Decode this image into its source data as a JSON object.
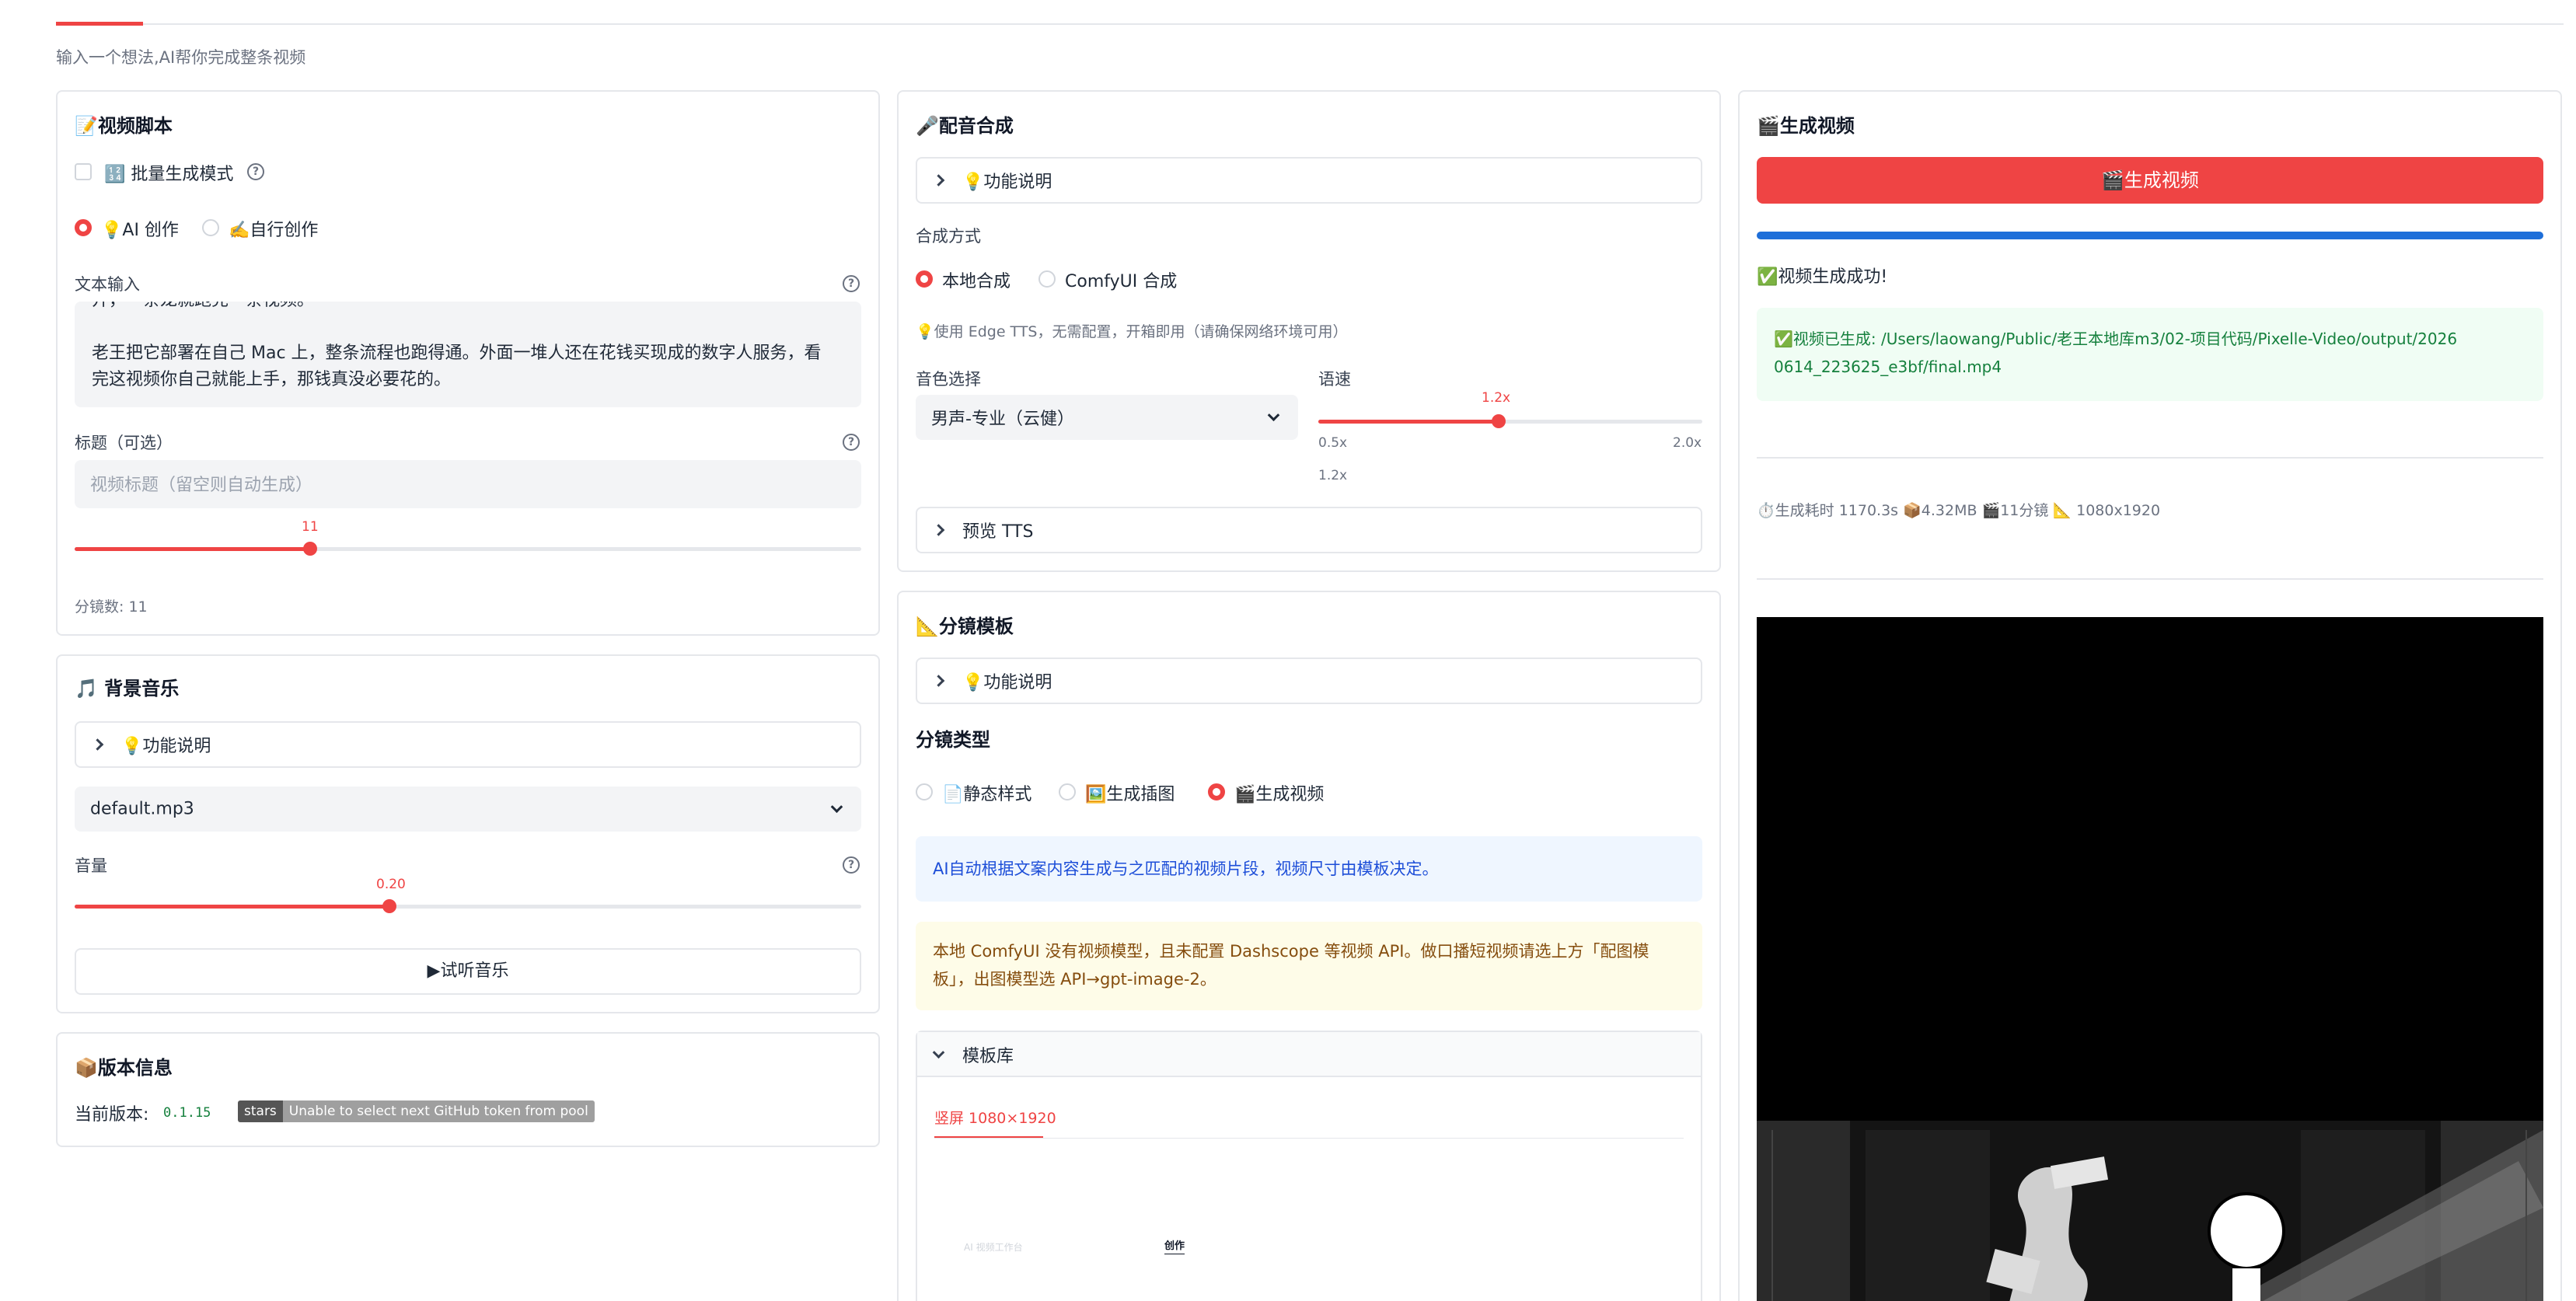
{
  "header": {
    "subtitle": "输入一个想法,AI帮你完成整条视频"
  },
  "script_panel": {
    "title": "📝视频脚本",
    "batch_label": "🔢 批量生成模式",
    "mode_ai": "💡AI 创作",
    "mode_self": "✍️自行创作",
    "text_label": "文本输入",
    "text_value": "开，一条龙就跑完一条视频。\n\n老王把它部署在自己 Mac 上，整条流程也跑得通。外面一堆人还在花钱买现成的数字人服务，看完这视频你自己就能上手，那钱真没必要花的。",
    "title_label": "标题（可选）",
    "title_placeholder": "视频标题（留空则自动生成）",
    "scenes_value": "11",
    "scenes_fraction": 0.3,
    "scenes_text": "分镜数: 11"
  },
  "bgm_panel": {
    "title": "🎵 背景音乐",
    "help_label": "💡功能说明",
    "selected": "default.mp3",
    "volume_label": "音量",
    "volume_value": "0.20",
    "volume_fraction": 0.4,
    "preview_label": "▶试听音乐"
  },
  "version_panel": {
    "title": "📦版本信息",
    "current_label": "当前版本:",
    "version": "0.1.15",
    "badge_left": "stars",
    "badge_right": "Unable to select next GitHub token from pool"
  },
  "tts_panel": {
    "title": "🎤配音合成",
    "help_label": "💡功能说明",
    "method_label": "合成方式",
    "method_local": "本地合成",
    "method_comfy": "ComfyUI 合成",
    "note": "💡使用 Edge TTS，无需配置，开箱即用（请确保网络环境可用）",
    "voice_label": "音色选择",
    "voice_value": "男声-专业（云健）",
    "speed_label": "语速",
    "speed_value": "1.2x",
    "speed_fraction": 0.47,
    "speed_min": "0.5x",
    "speed_max": "2.0x",
    "speed_readout": "1.2x",
    "preview_label": "预览 TTS"
  },
  "storyboard_panel": {
    "title": "📐分镜模板",
    "help_label": "💡功能说明",
    "type_label": "分镜类型",
    "type_static": "📄静态样式",
    "type_image": "🖼️生成插图",
    "type_video": "🎬生成视频",
    "info_blue": "AI自动根据文案内容生成与之匹配的视频片段，视频尺寸由模板决定。",
    "info_yellow": "本地 ComfyUI 没有视频模型，且未配置 Dashscope 等视频 API。做口播短视频请选上方「配图模板」，出图模型选 API→gpt-image-2。",
    "library_label": "模板库",
    "tab_portrait": "竖屏 1080×1920",
    "thumb_caption_1": "AI 视频工作台",
    "thumb_caption_2": "创作"
  },
  "generate_panel": {
    "title": "🎬生成视频",
    "button_label": "🎬生成视频",
    "progress_fraction": 1.0,
    "success_text": "✅视频生成成功!",
    "result_text": "✅视频已生成: /Users/laowang/Public/老王本地库m3/02-项目代码/Pixelle-Video/output/20260614_223625_e3bf/final.mp4",
    "stats": "⏱️生成耗时 1170.3s 📦4.32MB 🎬11分镜 📐 1080x1920"
  },
  "colors": {
    "accent": "#ef4444",
    "progress": "#1e6fd9",
    "info_blue_text": "#1d4ed8",
    "info_yellow_text": "#854d0e",
    "success_text": "#15803d"
  }
}
